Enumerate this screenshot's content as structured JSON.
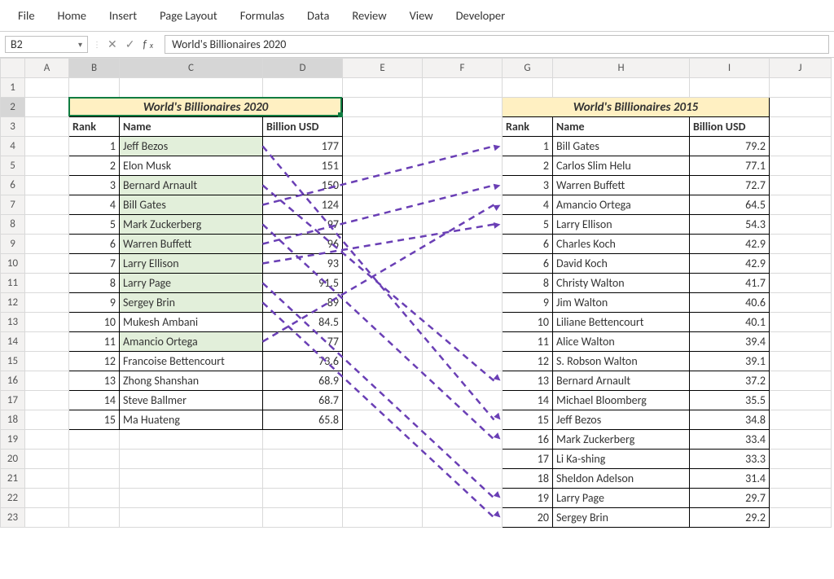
{
  "ribbon": [
    "File",
    "Home",
    "Insert",
    "Page Layout",
    "Formulas",
    "Data",
    "Review",
    "View",
    "Developer"
  ],
  "nameBox": "B2",
  "formula": "World's Billionaires 2020",
  "columns": [
    "A",
    "B",
    "C",
    "D",
    "E",
    "F",
    "G",
    "H",
    "I",
    "J"
  ],
  "rows": [
    "1",
    "2",
    "3",
    "4",
    "5",
    "6",
    "7",
    "8",
    "9",
    "10",
    "11",
    "12",
    "13",
    "14",
    "15",
    "16",
    "17",
    "18",
    "19",
    "20",
    "21",
    "22",
    "23"
  ],
  "table2020": {
    "title": "World's Billionaires 2020",
    "headers": {
      "rank": "Rank",
      "name": "Name",
      "usd": "Billion USD"
    },
    "rows": [
      {
        "rank": "1",
        "name": "Jeff Bezos",
        "usd": "177",
        "hl": true
      },
      {
        "rank": "2",
        "name": "Elon Musk",
        "usd": "151",
        "hl": false
      },
      {
        "rank": "3",
        "name": "Bernard Arnault",
        "usd": "150",
        "hl": true
      },
      {
        "rank": "4",
        "name": "Bill Gates",
        "usd": "124",
        "hl": true
      },
      {
        "rank": "5",
        "name": "Mark Zuckerberg",
        "usd": "97",
        "hl": true
      },
      {
        "rank": "6",
        "name": "Warren Buffett",
        "usd": "96",
        "hl": true
      },
      {
        "rank": "7",
        "name": "Larry Ellison",
        "usd": "93",
        "hl": true
      },
      {
        "rank": "8",
        "name": "Larry Page",
        "usd": "91.5",
        "hl": true
      },
      {
        "rank": "9",
        "name": "Sergey Brin",
        "usd": "89",
        "hl": true
      },
      {
        "rank": "10",
        "name": "Mukesh Ambani",
        "usd": "84.5",
        "hl": false
      },
      {
        "rank": "11",
        "name": "Amancio Ortega",
        "usd": "77",
        "hl": true
      },
      {
        "rank": "12",
        "name": "Francoise Bettencourt",
        "usd": "73.6",
        "hl": false
      },
      {
        "rank": "13",
        "name": "Zhong Shanshan",
        "usd": "68.9",
        "hl": false
      },
      {
        "rank": "14",
        "name": "Steve Ballmer",
        "usd": "68.7",
        "hl": false
      },
      {
        "rank": "15",
        "name": "Ma Huateng",
        "usd": "65.8",
        "hl": false
      }
    ]
  },
  "table2015": {
    "title": "World's Billionaires 2015",
    "headers": {
      "rank": "Rank",
      "name": "Name",
      "usd": "Billion USD"
    },
    "rows": [
      {
        "rank": "1",
        "name": "Bill Gates",
        "usd": "79.2"
      },
      {
        "rank": "2",
        "name": "Carlos Slim Helu",
        "usd": "77.1"
      },
      {
        "rank": "3",
        "name": "Warren Buffett",
        "usd": "72.7"
      },
      {
        "rank": "4",
        "name": "Amancio Ortega",
        "usd": "64.5"
      },
      {
        "rank": "5",
        "name": "Larry Ellison",
        "usd": "54.3"
      },
      {
        "rank": "6",
        "name": "Charles Koch",
        "usd": "42.9"
      },
      {
        "rank": "6",
        "name": "David Koch",
        "usd": "42.9"
      },
      {
        "rank": "8",
        "name": "Christy Walton",
        "usd": "41.7"
      },
      {
        "rank": "9",
        "name": "Jim Walton",
        "usd": "40.6"
      },
      {
        "rank": "10",
        "name": "Liliane Bettencourt",
        "usd": "40.1"
      },
      {
        "rank": "11",
        "name": "Alice Walton",
        "usd": "39.4"
      },
      {
        "rank": "12",
        "name": "S. Robson Walton",
        "usd": "39.1"
      },
      {
        "rank": "13",
        "name": "Bernard Arnault",
        "usd": "37.2"
      },
      {
        "rank": "14",
        "name": "Michael Bloomberg",
        "usd": "35.5"
      },
      {
        "rank": "15",
        "name": "Jeff Bezos",
        "usd": "34.8"
      },
      {
        "rank": "16",
        "name": "Mark Zuckerberg",
        "usd": "33.4"
      },
      {
        "rank": "17",
        "name": "Li Ka-shing",
        "usd": "33.3"
      },
      {
        "rank": "18",
        "name": "Sheldon Adelson",
        "usd": "31.4"
      },
      {
        "rank": "19",
        "name": "Larry Page",
        "usd": "29.7"
      },
      {
        "rank": "20",
        "name": "Sergey Brin",
        "usd": "29.2"
      }
    ]
  },
  "arrows": [
    {
      "from": 0,
      "to": 14
    },
    {
      "from": 2,
      "to": 12
    },
    {
      "from": 3,
      "to": 0
    },
    {
      "from": 4,
      "to": 15
    },
    {
      "from": 5,
      "to": 2
    },
    {
      "from": 6,
      "to": 4
    },
    {
      "from": 7,
      "to": 18
    },
    {
      "from": 8,
      "to": 19
    },
    {
      "from": 10,
      "to": 3
    }
  ]
}
